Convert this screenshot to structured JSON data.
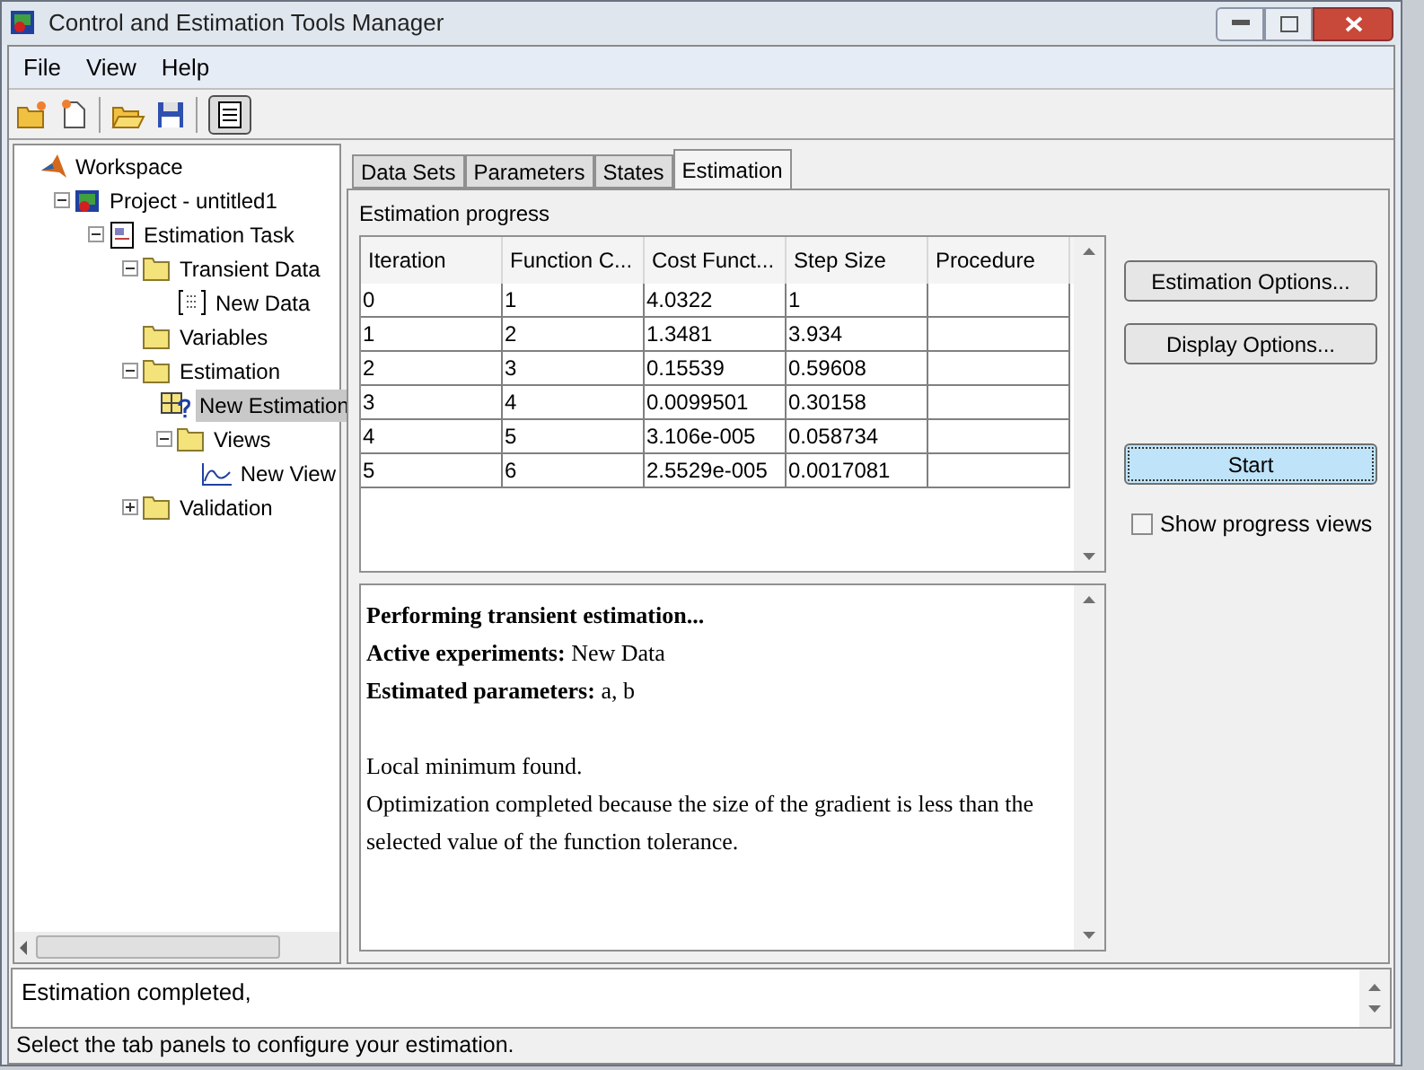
{
  "window": {
    "title": "Control and Estimation Tools Manager"
  },
  "menu": [
    "File",
    "View",
    "Help"
  ],
  "toolbar": [
    {
      "kind": "new-project"
    },
    {
      "kind": "new-task"
    },
    {
      "kind": "sep"
    },
    {
      "kind": "open"
    },
    {
      "kind": "save"
    },
    {
      "kind": "sep"
    },
    {
      "kind": "notes",
      "pressed": true
    }
  ],
  "tree": [
    {
      "label": "Workspace",
      "kind": "logo",
      "selected": false,
      "children": [
        {
          "label": "Project - untitled1",
          "kind": "project",
          "expanded": true,
          "selected": false,
          "children": [
            {
              "label": "Estimation Task",
              "kind": "task",
              "expanded": true,
              "selected": false,
              "children": [
                {
                  "label": "Transient Data",
                  "kind": "folder",
                  "expanded": true,
                  "selected": false,
                  "children": [
                    {
                      "label": "New Data",
                      "kind": "data",
                      "selected": false
                    }
                  ]
                },
                {
                  "label": "Variables",
                  "kind": "folder",
                  "selected": false
                },
                {
                  "label": "Estimation",
                  "kind": "folder",
                  "expanded": true,
                  "selected": false,
                  "children": [
                    {
                      "label": "New Estimation",
                      "kind": "estimation",
                      "selected": true
                    },
                    {
                      "label": "Views",
                      "kind": "folder",
                      "expanded": true,
                      "selected": false,
                      "children": [
                        {
                          "label": "New View",
                          "kind": "plot",
                          "selected": false
                        }
                      ]
                    }
                  ]
                },
                {
                  "label": "Validation",
                  "kind": "folder",
                  "expanded": false,
                  "selected": false
                }
              ]
            }
          ]
        }
      ]
    }
  ],
  "tabs": [
    {
      "label": "Data Sets",
      "selected": false
    },
    {
      "label": "Parameters",
      "selected": false
    },
    {
      "label": "States",
      "selected": false
    },
    {
      "label": "Estimation",
      "selected": true
    }
  ],
  "group_title": "Estimation progress",
  "table": {
    "columns": [
      "Iteration",
      "Function C...",
      "Cost Funct...",
      "Step Size",
      "Procedure"
    ],
    "rows": [
      [
        "0",
        "1",
        "4.0322",
        "1"
      ],
      [
        "1",
        "2",
        "1.3481",
        "3.934"
      ],
      [
        "2",
        "3",
        "0.15539",
        "0.59608"
      ],
      [
        "3",
        "4",
        "0.0099501",
        "0.30158"
      ],
      [
        "4",
        "5",
        "3.106e-005",
        "0.058734"
      ],
      [
        "5",
        "6",
        "2.5529e-005",
        "0.0017081"
      ]
    ]
  },
  "log": [
    {
      "text": "Performing transient estimation...",
      "bold": true,
      "gap_before": false
    },
    {
      "text": "**Active experiments:** New Data",
      "bold": false,
      "gap_before": false
    },
    {
      "text": "**Estimated parameters:** a, b",
      "bold": false,
      "gap_before": false
    },
    {
      "text": "Local minimum found.",
      "bold": false,
      "gap_before": true
    },
    {
      "text": "Optimization completed because the size of the gradient is less than the selected value of the function tolerance.",
      "bold": false,
      "gap_before": false
    }
  ],
  "buttons": [
    {
      "label": "Estimation Options...",
      "focused": false
    },
    {
      "label": "Display Options...",
      "focused": false
    },
    {
      "label": "Start",
      "focused": true
    }
  ],
  "show_progress_views": {
    "label": "Show progress views",
    "checked": false
  },
  "message": "Estimation completed,",
  "status_bar": "Select the tab panels to configure your estimation."
}
